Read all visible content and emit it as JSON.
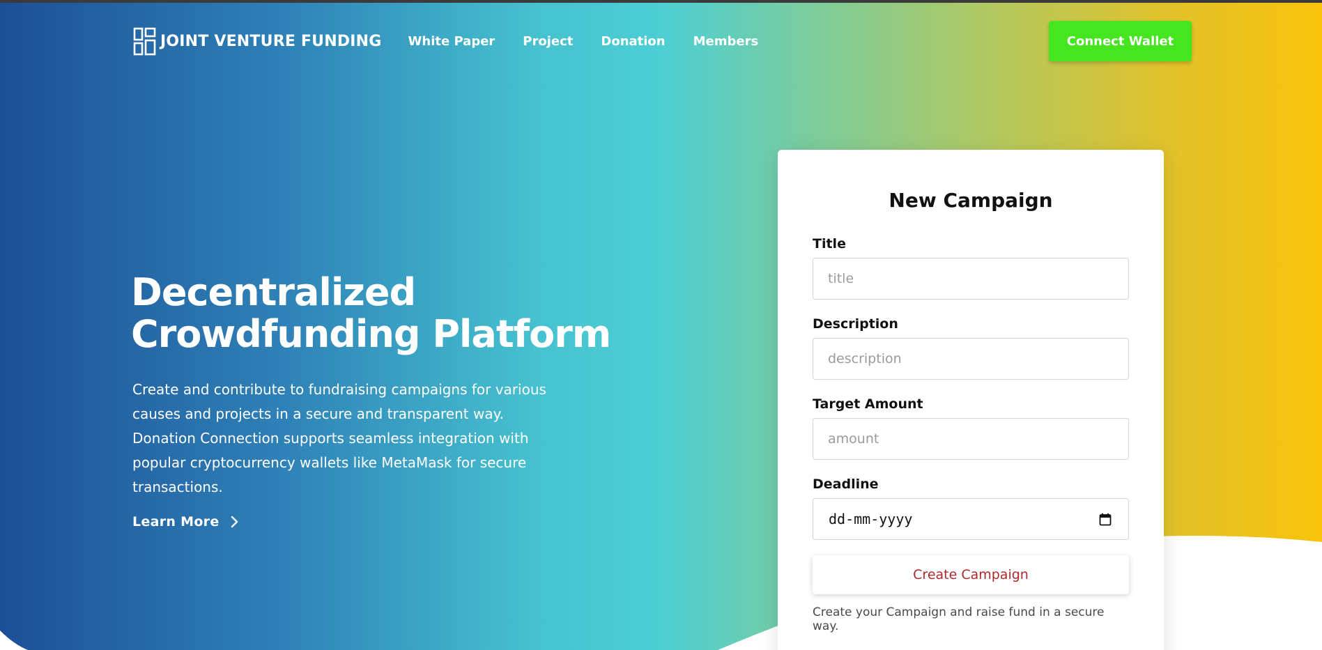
{
  "nav": {
    "brand": "JOINT VENTURE FUNDING",
    "brand_icon": "grid-logo-icon",
    "links": [
      "White Paper",
      "Project",
      "Donation",
      "Members"
    ],
    "connect_button": "Connect Wallet"
  },
  "hero": {
    "title_line1": "Decentralized",
    "title_line2": "Crowdfunding Platform",
    "description": "Create and contribute to fundraising campaigns for various causes and projects in a secure and transparent way. Donation Connection supports seamless integration with popular cryptocurrency wallets like MetaMask for secure transactions.",
    "learn_more": "Learn More",
    "learn_more_icon": "chevron-right-icon"
  },
  "form": {
    "heading": "New Campaign",
    "title_label": "Title",
    "title_placeholder": "title",
    "description_label": "Description",
    "description_placeholder": "description",
    "amount_label": "Target Amount",
    "amount_placeholder": "amount",
    "deadline_label": "Deadline",
    "deadline_placeholder": "dd-mm-yyyy",
    "deadline_icon": "calendar-icon",
    "submit": "Create Campaign",
    "note": "Create your Campaign and raise fund in a secure way."
  },
  "colors": {
    "gradient_start": "#1d4f96",
    "gradient_mid": "#4dcfd4",
    "gradient_end": "#f8c30a",
    "connect_button": "#45e51f",
    "submit_text": "#b0282a"
  }
}
